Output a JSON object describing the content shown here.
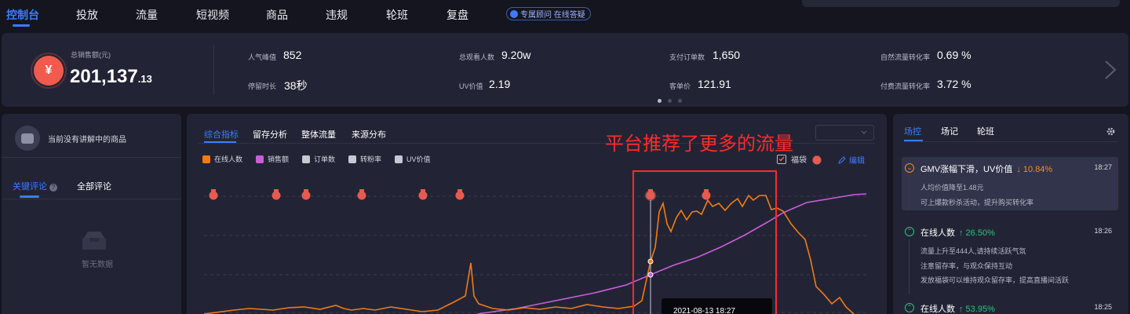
{
  "nav": {
    "items": [
      "控制台",
      "投放",
      "流量",
      "短视频",
      "商品",
      "违规",
      "轮班",
      "复盘"
    ],
    "active_index": 0,
    "badge": "专属顾问 在线答疑"
  },
  "stats": {
    "total_label": "总销售额(元)",
    "total_main": "201,137",
    "total_decimal": ".13",
    "currency_icon": "yen-icon",
    "items": [
      {
        "label": "人气峰值",
        "value": "852"
      },
      {
        "label": "停留时长",
        "value": "38秒"
      },
      {
        "label": "总观看人数",
        "value": "9.20w"
      },
      {
        "label": "UV价值",
        "value": "2.19"
      },
      {
        "label": "支付订单数",
        "value": "1,650"
      },
      {
        "label": "客单价",
        "value": "121.91"
      },
      {
        "label": "自然流量转化率",
        "value": "0.69 %"
      },
      {
        "label": "付费流量转化率",
        "value": "3.72 %"
      }
    ],
    "page_dots": 3,
    "active_dot": 0
  },
  "left_panel": {
    "title": "当前没有讲解中的商品",
    "tabs": [
      "关键评论",
      "全部评论"
    ],
    "active_tab": 0,
    "empty_text": "暂无数据"
  },
  "chart_panel": {
    "tabs": [
      "综合指标",
      "留存分析",
      "整体流量",
      "来源分布"
    ],
    "active_tab": 0,
    "annotation": "平台推荐了更多的流量",
    "lucky_bag_label": "福袋",
    "edit_label": "编辑",
    "tooltip_text": "2021-08-13 18:27",
    "legend": [
      {
        "name": "在线人数",
        "color": "#f27b14",
        "on": true
      },
      {
        "name": "销售额",
        "color": "#c85ed8",
        "on": true
      },
      {
        "name": "订单数",
        "color": "#c7c9d1",
        "on": false
      },
      {
        "name": "转粉率",
        "color": "#c7c9d1",
        "on": false
      },
      {
        "name": "UV价值",
        "color": "#c7c9d1",
        "on": false
      }
    ],
    "colors": {
      "online": "#f27b14",
      "sales": "#c85ed8",
      "highlight": "#ff2a2a",
      "accent": "#3d7cff"
    }
  },
  "right_panel": {
    "tabs": [
      "场控",
      "场记",
      "轮班"
    ],
    "active_tab": 0,
    "events": [
      {
        "title": "GMV涨幅下滑，UV价值",
        "delta": "↓ 10.84%",
        "dir": "down",
        "time": "18:27",
        "lines": [
          "人均价值降至1.48元",
          "可上爆款秒杀活动，提升购买转化率"
        ]
      },
      {
        "title": "在线人数",
        "delta": "↑ 26.50%",
        "dir": "up",
        "time": "18:26",
        "lines": [
          "流量上升至444人,请持续活跃气氛",
          "注意留存率，与观众保持互动",
          "发放福袋可以维持观众留存率，提高直播间活跃"
        ]
      },
      {
        "title": "在线人数",
        "delta": "↑ 53.95%",
        "dir": "up",
        "time": "18:25",
        "lines": []
      }
    ],
    "colors": {
      "up": "#2fc27a",
      "down": "#f5892a"
    }
  }
}
